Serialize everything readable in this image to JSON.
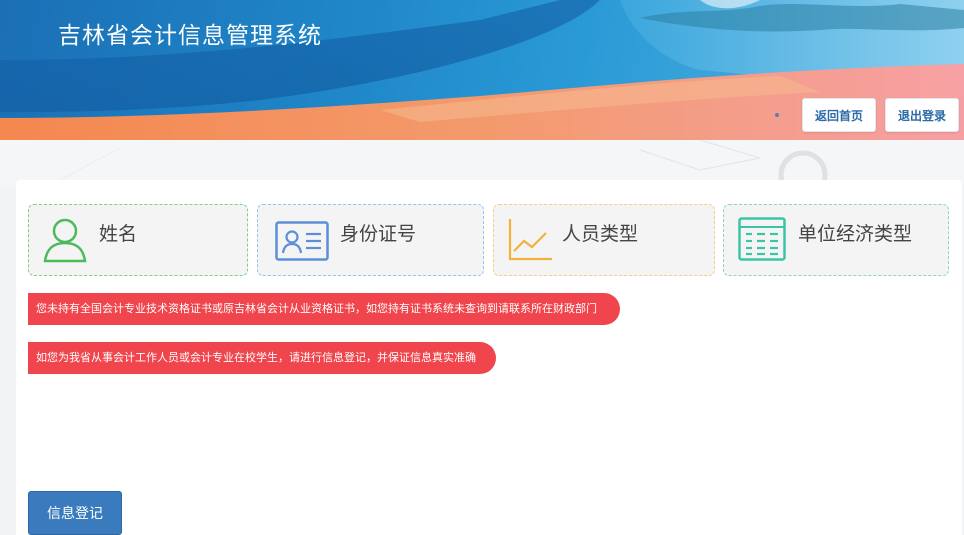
{
  "header": {
    "app_title": "吉林省会计信息管理系统",
    "home_button": "返回首页",
    "logout_button": "退出登录"
  },
  "cards": [
    {
      "label": "姓名",
      "icon": "user-icon",
      "color": "#4cba5b"
    },
    {
      "label": "身份证号",
      "icon": "id-card-icon",
      "color": "#5b8fd8"
    },
    {
      "label": "人员类型",
      "icon": "line-chart-icon",
      "color": "#f1b23f"
    },
    {
      "label": "单位经济类型",
      "icon": "table-list-icon",
      "color": "#3cc4a6"
    }
  ],
  "notices": [
    "您未持有全国会计专业技术资格证书或原吉林省会计从业资格证书，如您持有证书系统未查询到请联系所在财政部门",
    "如您为我省从事会计工作人员或会计专业在校学生，请进行信息登记，并保证信息真实准确"
  ],
  "register_button": "信息登记",
  "colors": {
    "notice_bg": "#f0454c",
    "primary_button": "#3a7bbd",
    "banner_blue": "#1f86c8",
    "banner_orange": "#f28a5a"
  }
}
